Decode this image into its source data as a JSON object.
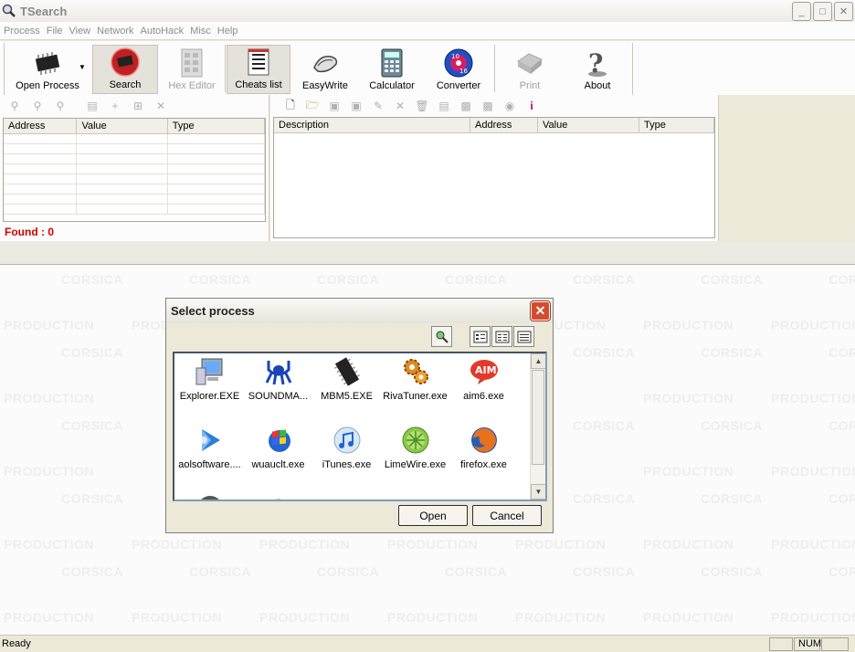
{
  "window": {
    "title": "TSearch"
  },
  "menu": {
    "items": [
      "Process",
      "File",
      "View",
      "Network",
      "AutoHack",
      "Misc",
      "Help"
    ]
  },
  "toolbar": {
    "open_process": "Open Process",
    "search": "Search",
    "hex_editor": "Hex Editor",
    "cheats_list": "Cheats list",
    "easywrite": "EasyWrite",
    "calculator": "Calculator",
    "converter": "Converter",
    "print": "Print",
    "about": "About"
  },
  "search_results": {
    "columns": [
      "Address",
      "Value",
      "Type"
    ],
    "found_label": "Found : 0"
  },
  "cheats": {
    "columns": [
      "Description",
      "Address",
      "Value",
      "Type"
    ]
  },
  "watermark": {
    "line1": "CORSICA",
    "line2": "PRODUCTION"
  },
  "dialog": {
    "title": "Select process",
    "processes": [
      "Explorer.EXE",
      "SOUNDMA...",
      "MBM5.EXE",
      "RivaTuner.exe",
      "aim6.exe",
      "aolsoftware....",
      "wuauclt.exe",
      "iTunes.exe",
      "LimeWire.exe",
      "firefox.exe"
    ],
    "open_button": "Open",
    "cancel_button": "Cancel"
  },
  "status": {
    "text": "Ready",
    "num": "NUM"
  }
}
